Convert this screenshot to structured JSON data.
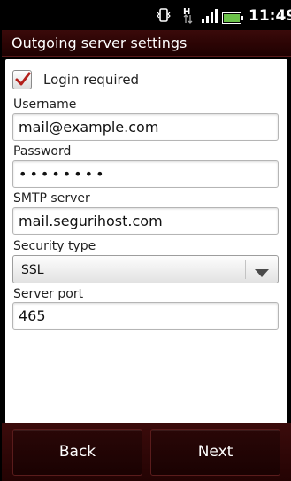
{
  "status_bar": {
    "time": "11:49",
    "data_indicator": "H",
    "icons": [
      "vibrate-icon",
      "data-transfer-icon",
      "signal-icon",
      "battery-icon"
    ]
  },
  "header": {
    "title": "Outgoing server settings"
  },
  "form": {
    "login_required": {
      "label": "Login required",
      "checked": true
    },
    "username": {
      "label": "Username",
      "value": "mail@example.com"
    },
    "password": {
      "label": "Password",
      "value": "••••••••"
    },
    "smtp_server": {
      "label": "SMTP server",
      "value": "mail.segurihost.com"
    },
    "security_type": {
      "label": "Security type",
      "selected": "SSL"
    },
    "server_port": {
      "label": "Server port",
      "value": "465"
    }
  },
  "footer": {
    "back_label": "Back",
    "next_label": "Next"
  },
  "colors": {
    "header_bg": "#2a0404",
    "checkmark": "#b3201b",
    "content_bg": "#ffffff"
  }
}
